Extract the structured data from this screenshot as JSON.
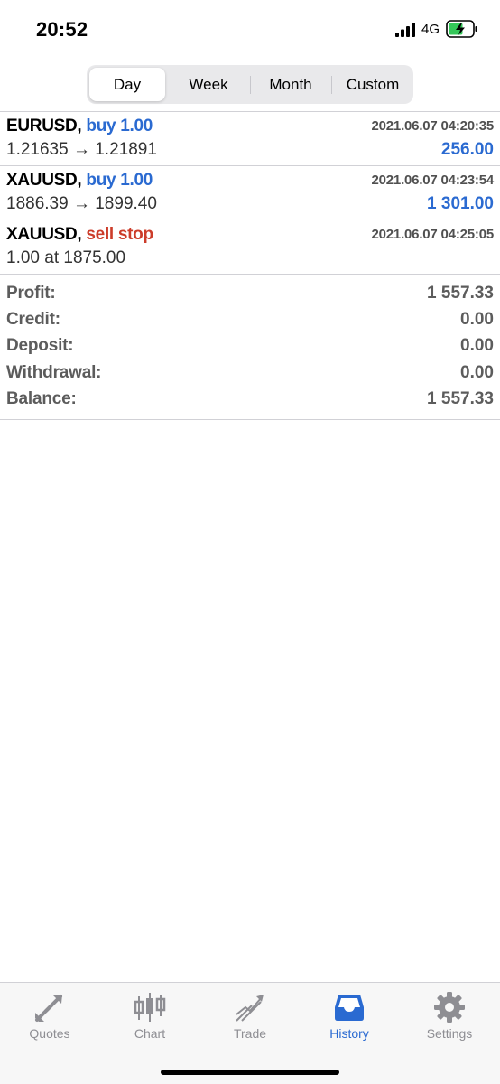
{
  "status_bar": {
    "time": "20:52",
    "network": "4G"
  },
  "period_tabs": [
    {
      "label": "Day",
      "active": true
    },
    {
      "label": "Week",
      "active": false
    },
    {
      "label": "Month",
      "active": false
    },
    {
      "label": "Custom",
      "active": false
    }
  ],
  "deals": [
    {
      "symbol": "EURUSD,",
      "action": "buy 1.00",
      "action_type": "buy",
      "time": "2021.06.07 04:20:35",
      "prices": "1.21635 → 1.21891",
      "profit": "256.00"
    },
    {
      "symbol": "XAUUSD,",
      "action": "buy 1.00",
      "action_type": "buy",
      "time": "2021.06.07 04:23:54",
      "prices": "1886.39 → 1899.40",
      "profit": "1 301.00"
    },
    {
      "symbol": "XAUUSD,",
      "action": "sell stop",
      "action_type": "sell",
      "time": "2021.06.07 04:25:05",
      "prices": "1.00 at 1875.00",
      "profit": ""
    }
  ],
  "summary": [
    {
      "label": "Profit:",
      "value": "1 557.33"
    },
    {
      "label": "Credit:",
      "value": "0.00"
    },
    {
      "label": "Deposit:",
      "value": "0.00"
    },
    {
      "label": "Withdrawal:",
      "value": "0.00"
    },
    {
      "label": "Balance:",
      "value": "1 557.33"
    }
  ],
  "tabbar": [
    {
      "label": "Quotes",
      "icon": "quotes-icon",
      "active": false
    },
    {
      "label": "Chart",
      "icon": "chart-icon",
      "active": false
    },
    {
      "label": "Trade",
      "icon": "trade-icon",
      "active": false
    },
    {
      "label": "History",
      "icon": "history-icon",
      "active": true
    },
    {
      "label": "Settings",
      "icon": "settings-icon",
      "active": false
    }
  ],
  "colors": {
    "accent": "#2a6ad1",
    "sell": "#cc3c2a",
    "inactive": "#8e8e93"
  }
}
